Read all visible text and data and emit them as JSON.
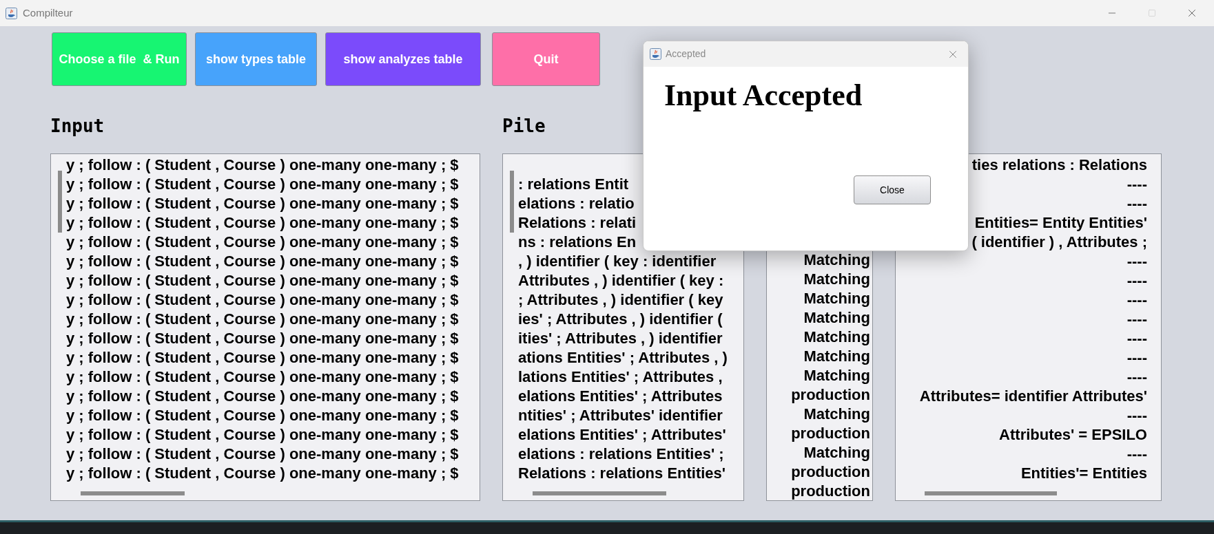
{
  "window": {
    "title": "Compilteur"
  },
  "buttons": [
    {
      "label": "Choose a file  & Run",
      "color": "#17f572"
    },
    {
      "label": "show types table",
      "color": "#47a3fb"
    },
    {
      "label": "show analyzes table",
      "color": "#7b4bfb"
    },
    {
      "label": "Quit",
      "color": "#fe6fa8"
    }
  ],
  "panels": [
    {
      "heading": "Input",
      "lines": [
        "y ; follow : ( Student , Course ) one-many one-many ; $",
        "y ; follow : ( Student , Course ) one-many one-many ; $",
        "y ; follow : ( Student , Course ) one-many one-many ; $",
        "y ; follow : ( Student , Course ) one-many one-many ; $",
        "y ; follow : ( Student , Course ) one-many one-many ; $",
        "y ; follow : ( Student , Course ) one-many one-many ; $",
        "y ; follow : ( Student , Course ) one-many one-many ; $",
        "y ; follow : ( Student , Course ) one-many one-many ; $",
        "y ; follow : ( Student , Course ) one-many one-many ; $",
        "y ; follow : ( Student , Course ) one-many one-many ; $",
        "y ; follow : ( Student , Course ) one-many one-many ; $",
        "y ; follow : ( Student , Course ) one-many one-many ; $",
        "y ; follow : ( Student , Course ) one-many one-many ; $",
        "y ; follow : ( Student , Course ) one-many one-many ; $",
        "y ; follow : ( Student , Course ) one-many one-many ; $",
        "y ; follow : ( Student , Course ) one-many one-many ; $",
        "y ; follow : ( Student , Course ) one-many one-many ; $"
      ]
    },
    {
      "heading": "Pile",
      "lines": [
        ": relations Entit",
        "elations : relatio",
        "Relations : relati",
        "ns : relations En",
        ", ) identifier ( key : identifier",
        "Attributes , ) identifier ( key :",
        "; Attributes , ) identifier ( key",
        "ies' ; Attributes , ) identifier (",
        "ities' ; Attributes , ) identifier",
        "ations Entities' ; Attributes , )",
        "lations Entities' ; Attributes ,",
        "elations Entities' ; Attributes",
        "ntities' ; Attributes' identifier",
        "elations Entities' ; Attributes'",
        "elations : relations Entities' ;",
        "Relations : relations Entities'"
      ]
    },
    {
      "lines": [
        "Matching",
        "Matching",
        "Matching",
        "Matching",
        "Matching",
        "Matching",
        "Matching",
        "production",
        "Matching",
        "production",
        "Matching",
        "production",
        "production"
      ]
    },
    {
      "lines": [
        "ties relations : Relations",
        "----",
        "----",
        "Entities= Entity Entities'",
        "( identifier ) , Attributes ;",
        "----",
        "----",
        "----",
        "----",
        "----",
        "----",
        "----",
        "Attributes= identifier Attributes'",
        "----",
        "Attributes' = EPSILO",
        "----",
        "Entities'= Entities"
      ]
    }
  ],
  "dialog": {
    "title": "Accepted",
    "message": "Input Accepted",
    "button": "Close"
  }
}
